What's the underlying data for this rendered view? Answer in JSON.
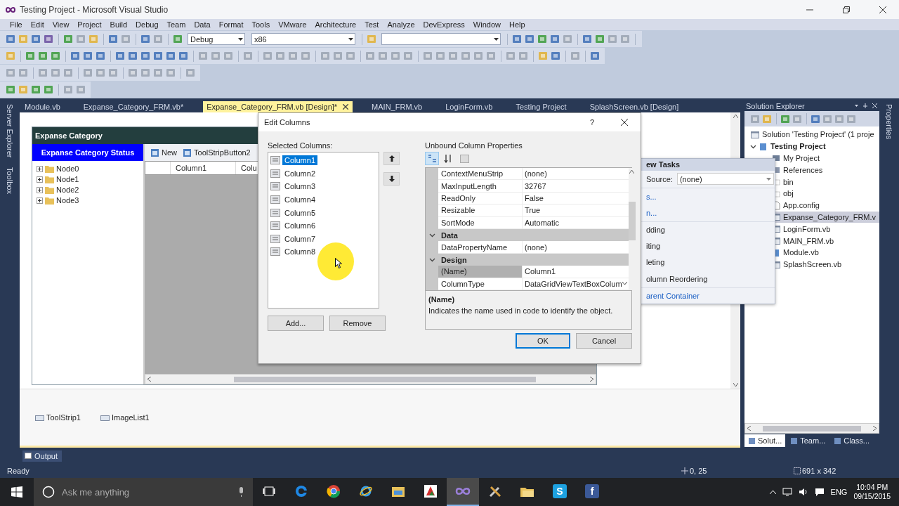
{
  "window": {
    "title": "Testing Project - Microsoft Visual Studio"
  },
  "menu": [
    "File",
    "Edit",
    "View",
    "Project",
    "Build",
    "Debug",
    "Team",
    "Data",
    "Format",
    "Tools",
    "VMware",
    "Architecture",
    "Test",
    "Analyze",
    "DevExpress",
    "Window",
    "Help"
  ],
  "toolbar": {
    "configuration": "Debug",
    "platform": "x86"
  },
  "left_tool_tabs": [
    "Server Explorer",
    "Toolbox"
  ],
  "document_tabs": [
    {
      "label": "Module.vb",
      "selected": false
    },
    {
      "label": "Expanse_Category_FRM.vb*",
      "selected": false
    },
    {
      "label": "Expanse_Category_FRM.vb [Design]*",
      "selected": true
    },
    {
      "label": "MAIN_FRM.vb",
      "selected": false
    },
    {
      "label": "LoginForm.vb",
      "selected": false
    },
    {
      "label": "Testing Project",
      "selected": false
    },
    {
      "label": "SplashScreen.vb [Design]",
      "selected": false
    }
  ],
  "form": {
    "title": "Expanse Category",
    "panel_header": "Expanse Category Status",
    "nodes": [
      {
        "label": "Node0",
        "expanded": false
      },
      {
        "label": "Node1",
        "expanded": false
      },
      {
        "label": "Node2",
        "expanded": false
      },
      {
        "label": "Node3",
        "expanded": false
      }
    ],
    "toolstrip": [
      "New",
      "ToolStripButton2"
    ],
    "grid_columns": [
      "Column1",
      "Colu"
    ]
  },
  "component_tray": [
    "ToolStrip1",
    "ImageList1"
  ],
  "tasks_panel": {
    "title": "ew Tasks",
    "source_label": "Source:",
    "source_value": "(none)",
    "items": [
      {
        "label": "s...",
        "kind": "link"
      },
      {
        "label": "n...",
        "kind": "link"
      },
      {
        "label": "dding",
        "kind": "option"
      },
      {
        "label": "iting",
        "kind": "option"
      },
      {
        "label": "leting",
        "kind": "option"
      },
      {
        "label": "olumn Reordering",
        "kind": "option"
      },
      {
        "label": "arent Container",
        "kind": "link"
      }
    ]
  },
  "dialog": {
    "title": "Edit Columns",
    "help": "?",
    "selected_label": "Selected Columns:",
    "columns": [
      {
        "label": "Column1",
        "selected": true
      },
      {
        "label": "Column2",
        "selected": false
      },
      {
        "label": "Column3",
        "selected": false
      },
      {
        "label": "Column4",
        "selected": false
      },
      {
        "label": "Column5",
        "selected": false
      },
      {
        "label": "Column6",
        "selected": false
      },
      {
        "label": "Column7",
        "selected": false
      },
      {
        "label": "Column8",
        "selected": false
      }
    ],
    "add": "Add...",
    "remove": "Remove",
    "properties_label": "Unbound Column Properties",
    "sort_buttons": [
      {
        "kind": "categorized",
        "selected": true
      },
      {
        "kind": "alphabetical",
        "selected": false
      }
    ],
    "properties": [
      {
        "kind": "property",
        "name": "ContextMenuStrip",
        "value": "(none)",
        "selected": false
      },
      {
        "kind": "property",
        "name": "MaxInputLength",
        "value": "32767",
        "selected": false
      },
      {
        "kind": "property",
        "name": "ReadOnly",
        "value": "False",
        "selected": false
      },
      {
        "kind": "property",
        "name": "Resizable",
        "value": "True",
        "selected": false
      },
      {
        "kind": "property",
        "name": "SortMode",
        "value": "Automatic",
        "selected": false
      },
      {
        "kind": "category",
        "name": "Data",
        "expanded": true
      },
      {
        "kind": "property",
        "name": "DataPropertyName",
        "value": "(none)",
        "selected": false
      },
      {
        "kind": "category",
        "name": "Design",
        "expanded": true
      },
      {
        "kind": "property",
        "name": "(Name)",
        "value": "Column1",
        "selected": true
      },
      {
        "kind": "property",
        "name": "ColumnType",
        "value": "DataGridViewTextBoxColum",
        "selected": false,
        "dropdown": true
      }
    ],
    "description_title": "(Name)",
    "description": "Indicates the name used in code to identify the object.",
    "ok": "OK",
    "cancel": "Cancel"
  },
  "solution_explorer": {
    "title": "Solution Explorer",
    "tree": {
      "label": "Solution 'Testing Project' (1 proje",
      "children": [
        {
          "label": "Testing Project",
          "expanded": true,
          "children": [
            {
              "label": "My Project",
              "kind": "wrench",
              "selected": false
            },
            {
              "label": "References",
              "kind": "references",
              "selected": false
            },
            {
              "label": "bin",
              "kind": "folder",
              "selected": false
            },
            {
              "label": "obj",
              "kind": "folder",
              "selected": false
            },
            {
              "label": "App.config",
              "kind": "file",
              "selected": false
            },
            {
              "label": "Expanse_Category_FRM.v",
              "kind": "form",
              "selected": true
            },
            {
              "label": "LoginForm.vb",
              "kind": "form",
              "selected": false
            },
            {
              "label": "MAIN_FRM.vb",
              "kind": "form",
              "selected": false
            },
            {
              "label": "Module.vb",
              "kind": "module",
              "selected": false
            },
            {
              "label": "SplashScreen.vb",
              "kind": "form",
              "selected": false
            }
          ]
        }
      ]
    },
    "tabs": [
      {
        "label": "Solut...",
        "selected": true
      },
      {
        "label": "Team...",
        "selected": false
      },
      {
        "label": "Class...",
        "selected": false
      }
    ]
  },
  "right_tool_tabs": [
    "Properties"
  ],
  "output_tab": "Output",
  "status_bar": {
    "text": "Ready",
    "position": "0, 25",
    "size": "691 x 342"
  },
  "taskbar": {
    "search_placeholder": "Ask me anything",
    "apps": [
      {
        "kind": "swirl",
        "selected": false
      },
      {
        "kind": "ball",
        "selected": false
      },
      {
        "kind": "orbit",
        "selected": false
      },
      {
        "kind": "cabinet",
        "selected": false
      },
      {
        "kind": "red-tile",
        "selected": false
      },
      {
        "kind": "loop",
        "selected": true
      },
      {
        "kind": "tools",
        "selected": false
      },
      {
        "kind": "folders",
        "selected": false
      },
      {
        "kind": "badge",
        "glyph": "S",
        "color": "#1da1e0",
        "selected": false
      },
      {
        "kind": "badge",
        "glyph": "f",
        "color": "#3b5998",
        "selected": false
      }
    ],
    "language": "ENG",
    "time": "10:04 PM",
    "date": "09/15/2015"
  }
}
